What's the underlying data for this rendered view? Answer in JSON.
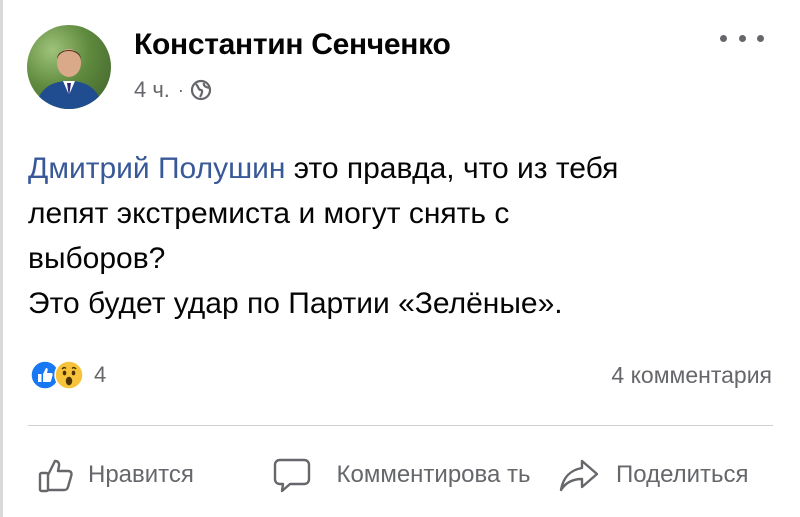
{
  "post": {
    "author": "Константин Сенченко",
    "time": "4 ч.",
    "separator": "·",
    "privacy_icon": "globe-icon",
    "mention": "Дмитрий Полушин",
    "text_line1": " это правда, что из тебя",
    "text_line2": "лепят экстремиста и могут снять с",
    "text_line3": "выборов?",
    "text_line4": "Это будет удар по Партии «Зелёные»."
  },
  "reactions": {
    "icons": [
      "like-icon",
      "wow-icon"
    ],
    "count": "4"
  },
  "comments": {
    "count_label": "4 комментария"
  },
  "actions": {
    "like_label": "Нравится",
    "comment_label": "Комментирова ть",
    "share_label": "Поделиться"
  },
  "colors": {
    "mention": "#385898",
    "secondary_text": "#65676b",
    "like_blue": "#1877f2",
    "wow_yellow": "#f7c33b"
  }
}
